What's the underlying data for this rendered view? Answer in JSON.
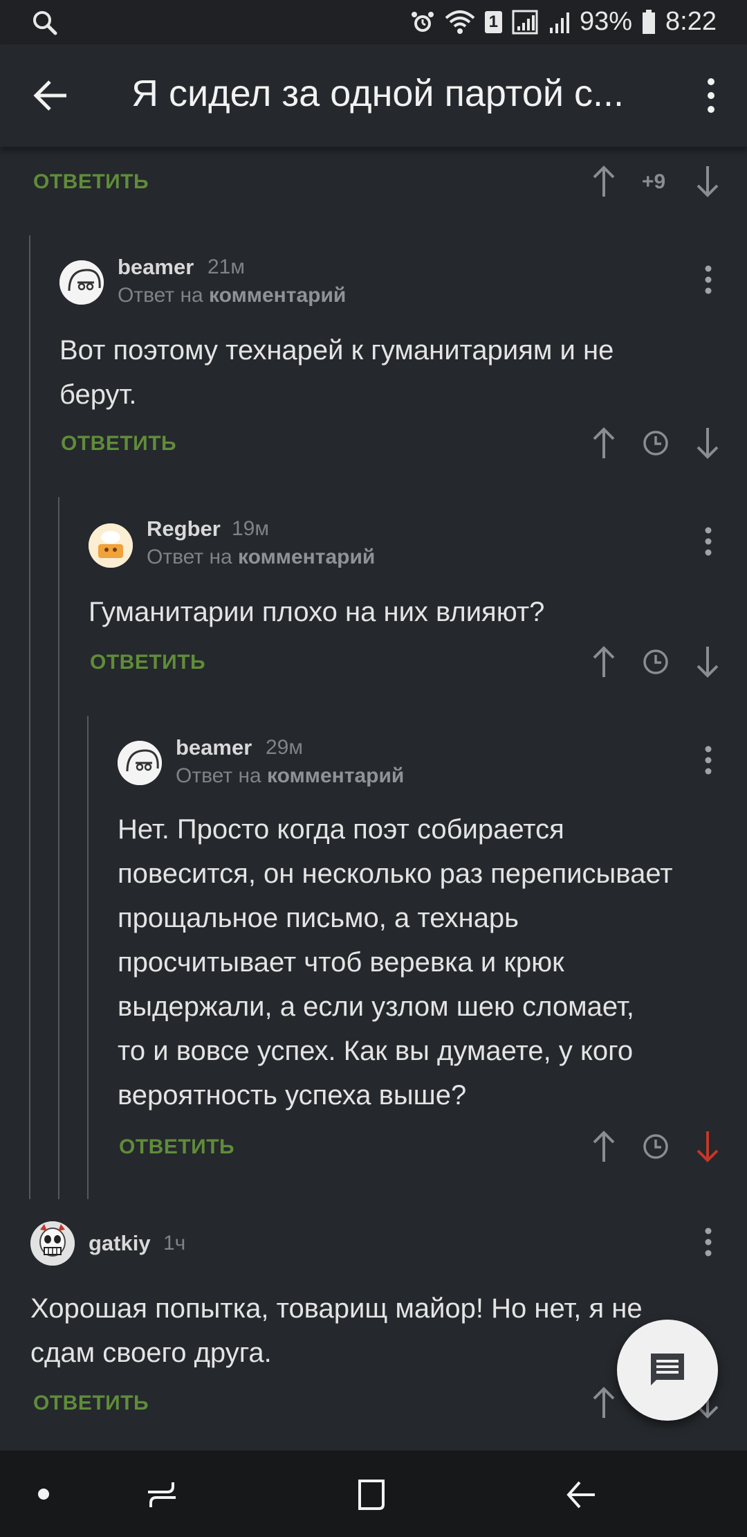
{
  "status_bar": {
    "battery": "93%",
    "time": "8:22",
    "sim": "1",
    "icons": [
      "search-icon",
      "alarm-icon",
      "wifi-icon",
      "signal-icon",
      "battery-icon"
    ]
  },
  "app_bar": {
    "title": "Я сидел за одной партой с..."
  },
  "reply_label": "ОТВЕТИТЬ",
  "top_comment": {
    "score": "+9"
  },
  "comments": [
    {
      "user": "beamer",
      "time": "21м",
      "reply_prefix": "Ответ на",
      "reply_target": "комментарий",
      "lines": [
        "Вот поэтому технарей к гуманитариям и не",
        "берут."
      ]
    },
    {
      "user": "Regber",
      "time": "19м",
      "reply_prefix": "Ответ на",
      "reply_target": "комментарий",
      "lines": [
        "Гуманитарии плохо на них влияют?"
      ]
    },
    {
      "user": "beamer",
      "time": "29м",
      "reply_prefix": "Ответ на",
      "reply_target": "комментарий",
      "lines": [
        "Нет. Просто когда поэт собирается",
        "повесится, он несколько раз переписывает",
        "прощальное письмо, а технарь",
        "просчитывает чтоб веревка и крюк",
        "выдержали, а если узлом шею сломает,",
        "то и вовсе успех. Как вы думаете, у кого",
        "вероятность успеха выше?"
      ]
    },
    {
      "user": "gatkiy",
      "time": "1ч",
      "lines": [
        "Хорошая попытка, товарищ майор! Но нет, я не",
        "сдам своего друга."
      ]
    }
  ],
  "colors": {
    "background": "#25282c",
    "reply_green": "#5f8c3a",
    "downvote_active": "#c0392b"
  }
}
